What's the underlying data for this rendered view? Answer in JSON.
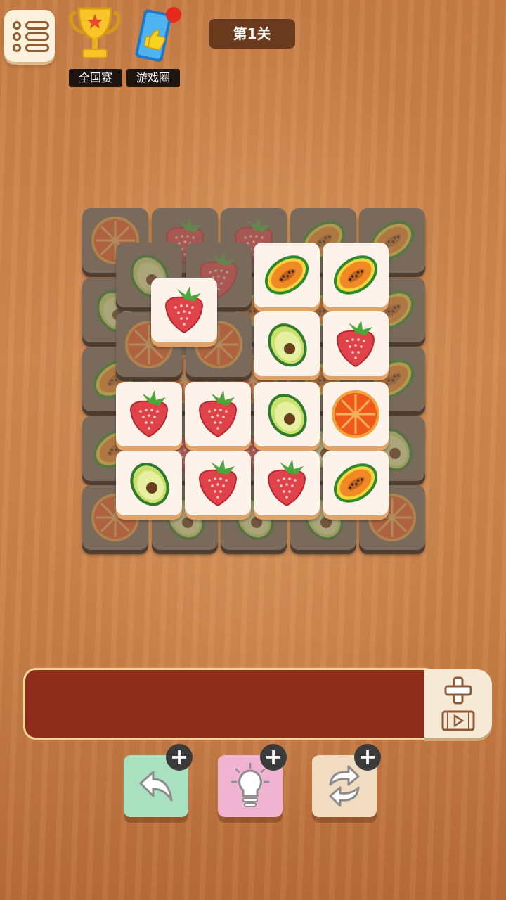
{
  "header": {
    "level_label": "第1关",
    "badges": [
      {
        "label": "全国赛",
        "icon": "trophy-icon"
      },
      {
        "label": "游戏圈",
        "icon": "game-circle-icon",
        "notification": true
      }
    ],
    "menu_icon": "menu-list-icon"
  },
  "board": {
    "tile_types": [
      "papaya",
      "strawberry",
      "avocado",
      "orange-slice"
    ],
    "bottom_layer_row0": [
      "orange-slice",
      "strawberry",
      "strawberry",
      "papaya",
      "papaya"
    ],
    "top_tiles": [
      {
        "row": 0,
        "col": 2,
        "fruit": "papaya"
      },
      {
        "row": 0,
        "col": 3,
        "fruit": "papaya"
      },
      {
        "row": 1,
        "col": 2,
        "fruit": "avocado"
      },
      {
        "row": 1,
        "col": 3,
        "fruit": "strawberry"
      },
      {
        "row": 2,
        "col": 0,
        "fruit": "strawberry"
      },
      {
        "row": 2,
        "col": 1,
        "fruit": "strawberry"
      },
      {
        "row": 2,
        "col": 2,
        "fruit": "avocado"
      },
      {
        "row": 2,
        "col": 3,
        "fruit": "orange-slice"
      },
      {
        "row": 3,
        "col": 0,
        "fruit": "avocado"
      },
      {
        "row": 3,
        "col": 1,
        "fruit": "strawberry"
      },
      {
        "row": 3,
        "col": 2,
        "fruit": "strawberry"
      },
      {
        "row": 3,
        "col": 3,
        "fruit": "papaya"
      }
    ],
    "loose_tile": {
      "fruit": "strawberry"
    }
  },
  "tray": {
    "slots_filled": 0,
    "add_slot_icon": "plus-video-icon"
  },
  "powerups": [
    {
      "name": "undo",
      "icon": "undo-arrow-icon",
      "color": "#a8e0c0"
    },
    {
      "name": "hint",
      "icon": "lightbulb-icon",
      "color": "#f0b3d2"
    },
    {
      "name": "shuffle",
      "icon": "shuffle-icon",
      "color": "#f1dcc1"
    }
  ],
  "colors": {
    "tile_face": "#fdf3ea",
    "tile_edge": "#e3a266",
    "tray_fill": "#8c2c19",
    "level_bg": "#6a3a1c"
  }
}
